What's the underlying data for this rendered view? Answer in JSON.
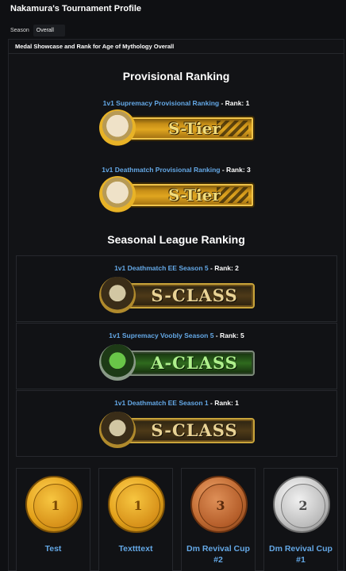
{
  "page": {
    "title": "Nakamura's Tournament Profile"
  },
  "season": {
    "label": "Season",
    "value": "Overall"
  },
  "showcase": {
    "header": "Medal Showcase and Rank for Age of Mythology Overall",
    "provisional": {
      "title": "Provisional Ranking",
      "items": [
        {
          "link": "1v1 Supremacy Provisional Ranking",
          "rank": " - Rank: 1",
          "badge": "S-Tier"
        },
        {
          "link": "1v1 Deathmatch Provisional Ranking",
          "rank": " - Rank: 3",
          "badge": "S-Tier"
        }
      ]
    },
    "seasonal": {
      "title": "Seasonal League Ranking",
      "items": [
        {
          "link": "1v1 Deathmatch EE Season 5",
          "rank": " - Rank: 2",
          "badge": "S-CLASS"
        },
        {
          "link": "1v1 Supremacy Voobly Season 5",
          "rank": " - Rank: 5",
          "badge": "A-CLASS"
        },
        {
          "link": "1v1 Deathmatch EE Season 1",
          "rank": " - Rank: 1",
          "badge": "S-CLASS"
        }
      ]
    },
    "medals": [
      {
        "name": "Test",
        "place": "1",
        "metal": "gold"
      },
      {
        "name": "Textttext",
        "place": "1",
        "metal": "gold"
      },
      {
        "name": "Dm Revival Cup #2",
        "place": "3",
        "metal": "bronze"
      },
      {
        "name": "Dm Revival Cup #1",
        "place": "2",
        "metal": "silver"
      }
    ]
  },
  "colors": {
    "background": "#0f1013",
    "link": "#64a8e6",
    "gold": "#e4a21a",
    "bronze": "#c06a32",
    "silver": "#c7c7c7"
  }
}
